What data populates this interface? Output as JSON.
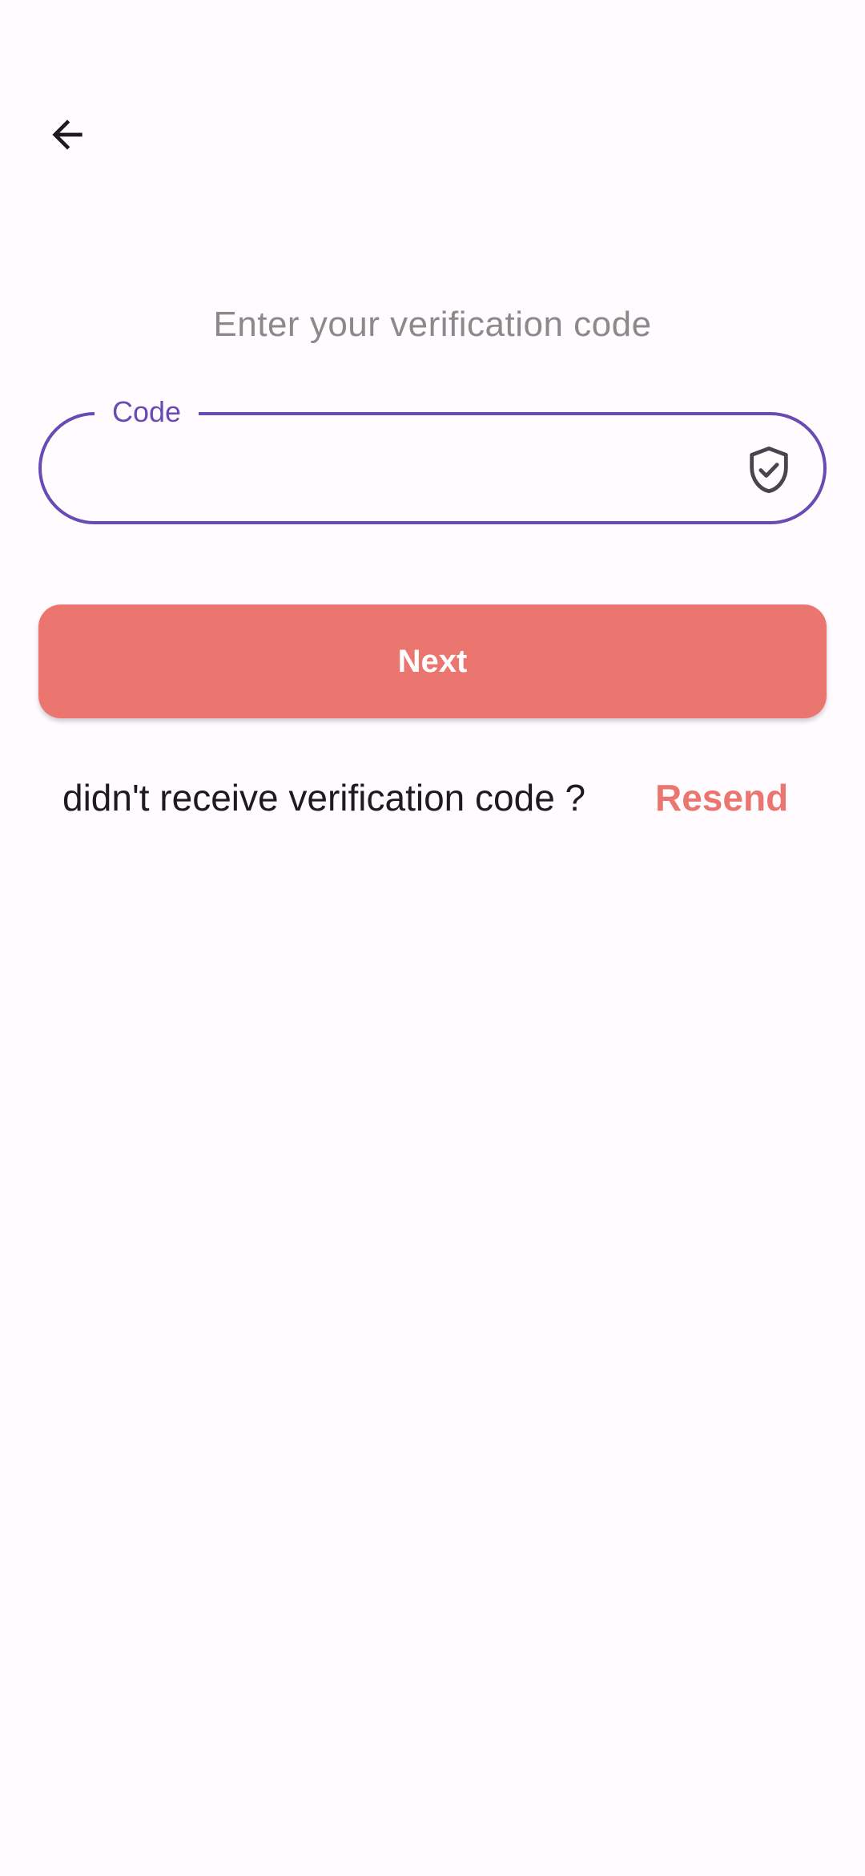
{
  "header": {
    "back_icon": "arrow-left-icon"
  },
  "instruction": "Enter your verification code",
  "code_field": {
    "label": "Code",
    "value": "",
    "icon": "shield-check-icon",
    "accent_color": "#6a4bb3"
  },
  "next_button": {
    "label": "Next",
    "color": "#eb7670"
  },
  "resend": {
    "prompt": "didn't receive verification code ?",
    "link_label": "Resend",
    "color": "#eb7670"
  }
}
